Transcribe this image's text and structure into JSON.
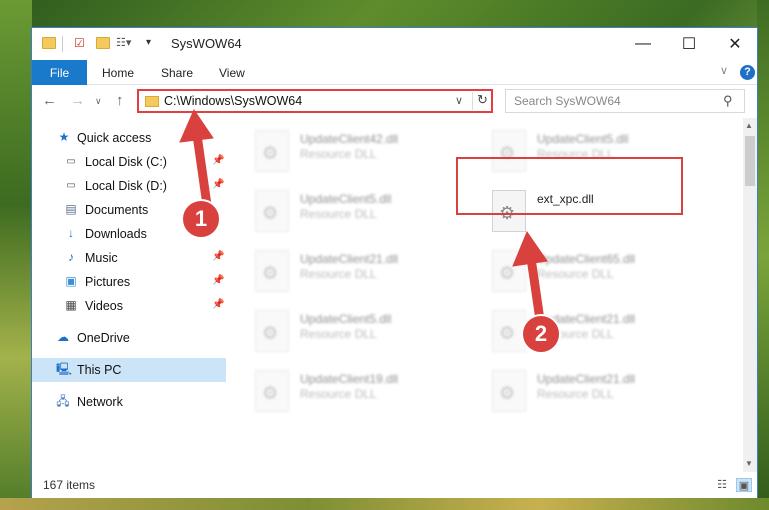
{
  "window": {
    "title": "SysWOW64"
  },
  "ribbon": {
    "tabs": [
      "File",
      "Home",
      "Share",
      "View"
    ]
  },
  "navbar": {
    "address": "C:\\Windows\\SysWOW64",
    "search_placeholder": "Search SysWOW64"
  },
  "sidebar": {
    "items": [
      {
        "label": "Quick access",
        "icon": "star-icon"
      },
      {
        "label": "Local Disk (C:)",
        "icon": "drive-icon"
      },
      {
        "label": "Local Disk (D:)",
        "icon": "drive-icon"
      },
      {
        "label": "Documents",
        "icon": "documents-icon"
      },
      {
        "label": "Downloads",
        "icon": "download-icon"
      },
      {
        "label": "Music",
        "icon": "music-icon"
      },
      {
        "label": "Pictures",
        "icon": "pictures-icon"
      },
      {
        "label": "Videos",
        "icon": "videos-icon"
      },
      {
        "label": "OneDrive",
        "icon": "cloud-icon"
      },
      {
        "label": "This PC",
        "icon": "computer-icon"
      },
      {
        "label": "Network",
        "icon": "network-icon"
      }
    ],
    "selected": "This PC"
  },
  "files": [
    {
      "name": "UpdateClient42.dll",
      "type": "Resource DLL"
    },
    {
      "name": "UpdateClient5.dll",
      "type": "Resource DLL"
    },
    {
      "name": "UpdateClient5.dll",
      "type": "Resource DLL"
    },
    {
      "name": "ext_xpc.dll",
      "type": ""
    },
    {
      "name": "UpdateClient21.dll",
      "type": "Resource DLL"
    },
    {
      "name": "UpdateClient65.dll",
      "type": "Resource DLL"
    },
    {
      "name": "UpdateClient5.dll",
      "type": "Resource DLL"
    },
    {
      "name": "UpdateClient21.dll",
      "type": "Resource DLL"
    },
    {
      "name": "UpdateClient19.dll",
      "type": "Resource DLL"
    },
    {
      "name": "UpdateClient21.dll",
      "type": "Resource DLL"
    }
  ],
  "status": {
    "item_count": "167 items"
  },
  "callouts": {
    "one": "1",
    "two": "2"
  },
  "colors": {
    "accent": "#1979ca",
    "highlight": "#d9413e",
    "selected_bg": "#cce4f7"
  }
}
